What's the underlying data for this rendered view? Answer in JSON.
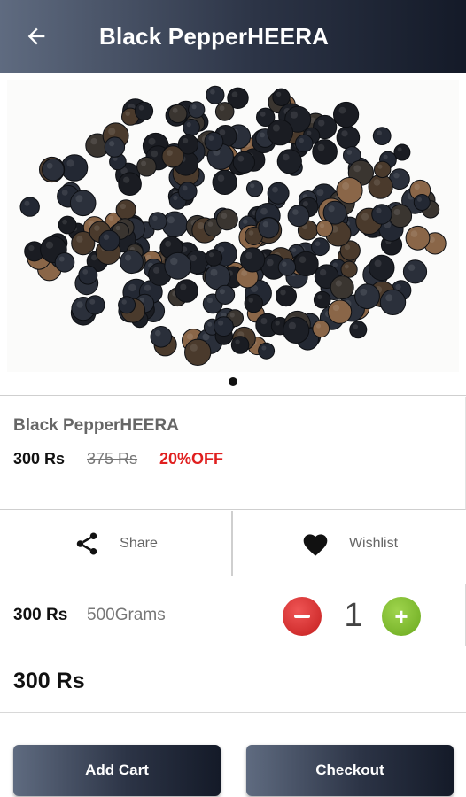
{
  "appbar": {
    "title": "Black PepperHEERA",
    "back_icon": "arrow-left-icon"
  },
  "gallery": {
    "image_subject": "black peppercorns",
    "pager_dots": 1,
    "active_dot": 1
  },
  "product": {
    "name": "Black PepperHEERA",
    "price": "300 Rs",
    "mrp": "375 Rs",
    "discount": "20%OFF",
    "discount_color": "#e01f1f"
  },
  "actions": {
    "share_label": "Share",
    "share_icon": "share-icon",
    "wishlist_label": "Wishlist",
    "wishlist_icon": "heart-icon"
  },
  "variant": {
    "price": "300 Rs",
    "weight": "500Grams",
    "quantity": "1",
    "minus_color": "#d32a2a",
    "plus_color": "#8cc63f"
  },
  "total": {
    "value": "300 Rs"
  },
  "buttons": {
    "add_cart": "Add Cart",
    "checkout": "Checkout"
  },
  "theme": {
    "header_gradient_start": "#5f6b80",
    "header_gradient_end": "#141a28"
  }
}
